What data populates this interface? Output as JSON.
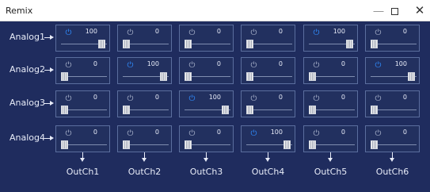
{
  "window": {
    "title": "Remix",
    "minimize_label": "—",
    "close_label": "✕"
  },
  "colors": {
    "background": "#1f2c5e",
    "power_on": "#2f8cff",
    "power_off": "#a9b3cc"
  },
  "rows": [
    {
      "label": "Analog1",
      "cells": [
        {
          "power": "on",
          "value": "100"
        },
        {
          "power": "off",
          "value": "0"
        },
        {
          "power": "off",
          "value": "0"
        },
        {
          "power": "off",
          "value": "0"
        },
        {
          "power": "on",
          "value": "100"
        },
        {
          "power": "off",
          "value": "0"
        }
      ]
    },
    {
      "label": "Analog2",
      "cells": [
        {
          "power": "off",
          "value": "0"
        },
        {
          "power": "on",
          "value": "100"
        },
        {
          "power": "off",
          "value": "0"
        },
        {
          "power": "off",
          "value": "0"
        },
        {
          "power": "off",
          "value": "0"
        },
        {
          "power": "on",
          "value": "100"
        }
      ]
    },
    {
      "label": "Analog3",
      "cells": [
        {
          "power": "off",
          "value": "0"
        },
        {
          "power": "off",
          "value": "0"
        },
        {
          "power": "on",
          "value": "100"
        },
        {
          "power": "off",
          "value": "0"
        },
        {
          "power": "off",
          "value": "0"
        },
        {
          "power": "off",
          "value": "0"
        }
      ]
    },
    {
      "label": "Analog4",
      "cells": [
        {
          "power": "off",
          "value": "0"
        },
        {
          "power": "off",
          "value": "0"
        },
        {
          "power": "off",
          "value": "0"
        },
        {
          "power": "on",
          "value": "100"
        },
        {
          "power": "off",
          "value": "0"
        },
        {
          "power": "off",
          "value": "0"
        }
      ]
    }
  ],
  "outputs": [
    "OutCh1",
    "OutCh2",
    "OutCh3",
    "OutCh4",
    "OutCh5",
    "OutCh6"
  ]
}
